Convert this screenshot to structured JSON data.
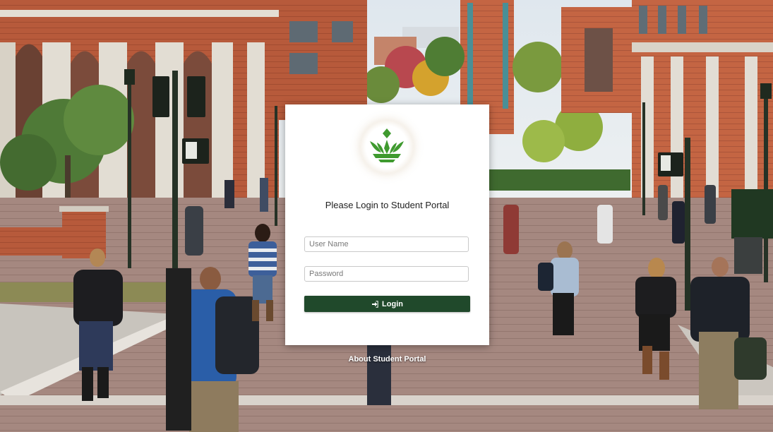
{
  "login": {
    "title": "Please Login to Student Portal",
    "username_placeholder": "User Name",
    "password_placeholder": "Password",
    "username_value": "",
    "password_value": "",
    "submit_label": "Login"
  },
  "footer": {
    "about_label": "About Student Portal"
  },
  "icons": {
    "logo": "lotus-crown-logo",
    "login": "sign-in-icon"
  },
  "colors": {
    "brand_green": "#20492b",
    "logo_green": "#3f9a2f"
  }
}
